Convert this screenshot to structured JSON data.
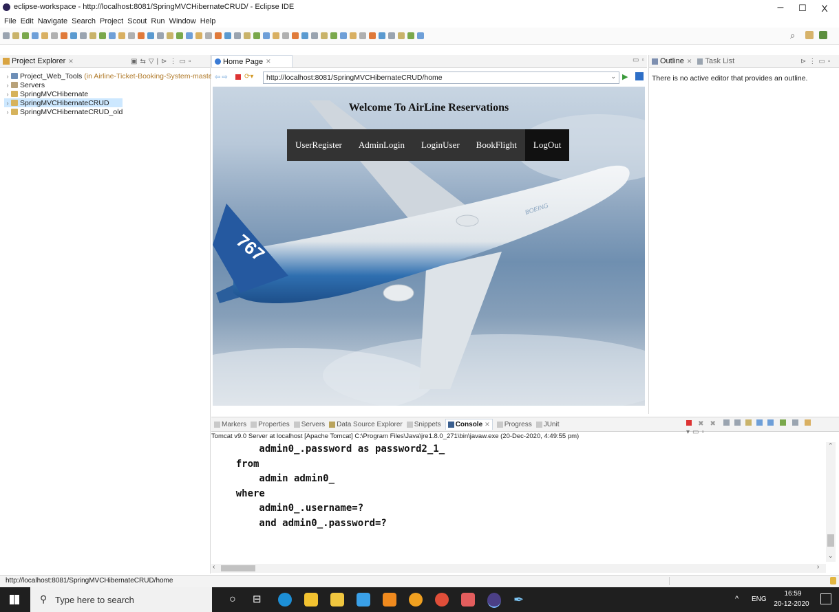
{
  "window": {
    "title": "eclipse-workspace - http://localhost:8081/SpringMVCHibernateCRUD/ - Eclipse IDE",
    "minimize": "–",
    "maximize": "☐",
    "close": "X"
  },
  "menu": [
    "File",
    "Edit",
    "Navigate",
    "Search",
    "Project",
    "Scout",
    "Run",
    "Window",
    "Help"
  ],
  "explorer": {
    "tab_label": "Project Explorer",
    "items": [
      {
        "label": "Project_Web_Tools",
        "suffix": "(in Airline-Ticket-Booking-System-master)",
        "type": "folder"
      },
      {
        "label": "Servers",
        "suffix": "",
        "type": "folder"
      },
      {
        "label": "SpringMVCHibernate",
        "suffix": "",
        "type": "project"
      },
      {
        "label": "SpringMVCHibernateCRUD",
        "suffix": "",
        "type": "project",
        "selected": true
      },
      {
        "label": "SpringMVCHibernateCRUD_old",
        "suffix": "",
        "type": "project"
      }
    ]
  },
  "browser": {
    "tab_label": "Home Page",
    "url": "http://localhost:8081/SpringMVCHibernateCRUD/home",
    "page": {
      "heading": "Welcome To AirLine Reservations",
      "nav": [
        "UserRegister",
        "AdminLogin",
        "LoginUser",
        "BookFlight",
        "LogOut"
      ],
      "nav_selected": "LogOut",
      "tail_number": "767",
      "brand": "BOEING"
    }
  },
  "outline": {
    "tab_label": "Outline",
    "tab2_label": "Task List",
    "message": "There is no active editor that provides an outline."
  },
  "console": {
    "tabs": [
      "Markers",
      "Properties",
      "Servers",
      "Data Source Explorer",
      "Snippets",
      "Console",
      "Progress",
      "JUnit"
    ],
    "active_tab": "Console",
    "server_line": "Tomcat v9.0 Server at localhost [Apache Tomcat] C:\\Program Files\\Java\\jre1.8.0_271\\bin\\javaw.exe  (20-Dec-2020, 4:49:55 pm)",
    "lines": [
      "        admin0_.password as password2_1_",
      "    from",
      "        admin admin0_",
      "    where",
      "        admin0_.username=?",
      "        and admin0_.password=?"
    ]
  },
  "status_bar": {
    "text": "http://localhost:8081/SpringMVCHibernateCRUD/home"
  },
  "taskbar": {
    "search_placeholder": "Type here to search",
    "lang": "ENG",
    "time": "16:59",
    "date": "20-12-2020"
  },
  "colors": {
    "navbar": "#333333",
    "nav_selected": "#111111",
    "selection": "#cde8ff",
    "taskbar": "#1f1f1f"
  }
}
